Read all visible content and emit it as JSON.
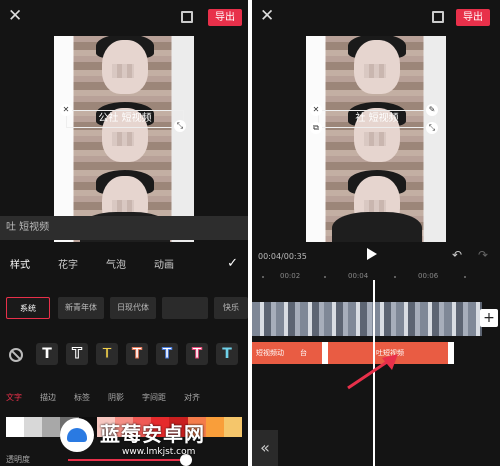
{
  "left": {
    "close_glyph": "✕",
    "export_label": "导出",
    "subtitle_text": "公社  短视频",
    "text_input_value": "吐 短视频",
    "tabs": [
      "样式",
      "花字",
      "气泡",
      "动画"
    ],
    "confirm_glyph": "✓",
    "fonts": [
      "系统",
      "新青年体",
      "日现代体",
      "",
      "快乐"
    ],
    "subtabs": [
      "文字",
      "描边",
      "标签",
      "阴影",
      "字间距",
      "对齐"
    ],
    "swatch_colors": [
      "#ffffff",
      "#d8d8d8",
      "#a8a8a8",
      "#6e6e6e",
      "#0d0d0d",
      "#f7c7c0",
      "#f48f85",
      "#ef5a55",
      "#e52a2c",
      "#c91f1f",
      "#f47c4a",
      "#f99e3a",
      "#f5c66b"
    ],
    "opacity_label": "透明度"
  },
  "right": {
    "close_glyph": "✕",
    "export_label": "导出",
    "subtitle_text": "社  短视频",
    "time_readout": "00:04/00:35",
    "ruler_ticks": [
      "00:02",
      "00:04",
      "00:06"
    ],
    "track_segments": [
      "短视频动",
      "台",
      "吐短视频"
    ],
    "add_glyph": "+",
    "back_glyph": "«"
  },
  "watermark": {
    "title": "蓝莓安卓网",
    "url": "www.lmkjst.com"
  },
  "accent_color": "#e8304a"
}
